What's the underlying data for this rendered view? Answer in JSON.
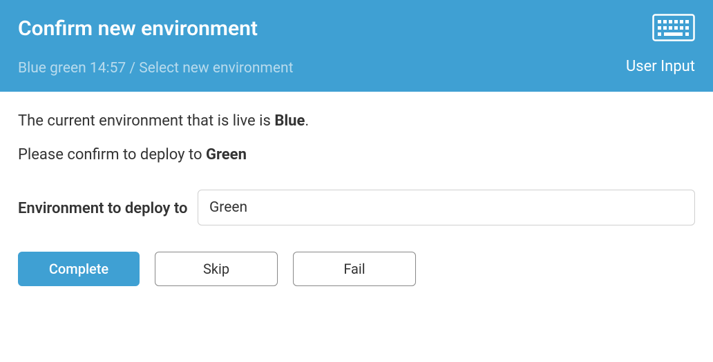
{
  "header": {
    "title": "Confirm new environment",
    "breadcrumb": "Blue green 14:57 / Select new environment",
    "user_input_label": "User Input"
  },
  "body": {
    "line1_prefix": "The current environment that is live is ",
    "line1_bold": "Blue",
    "line1_suffix": ".",
    "line2_prefix": "Please confirm to deploy to ",
    "line2_bold": "Green"
  },
  "form": {
    "label": "Environment to deploy to",
    "value": "Green"
  },
  "buttons": {
    "complete": "Complete",
    "skip": "Skip",
    "fail": "Fail"
  }
}
